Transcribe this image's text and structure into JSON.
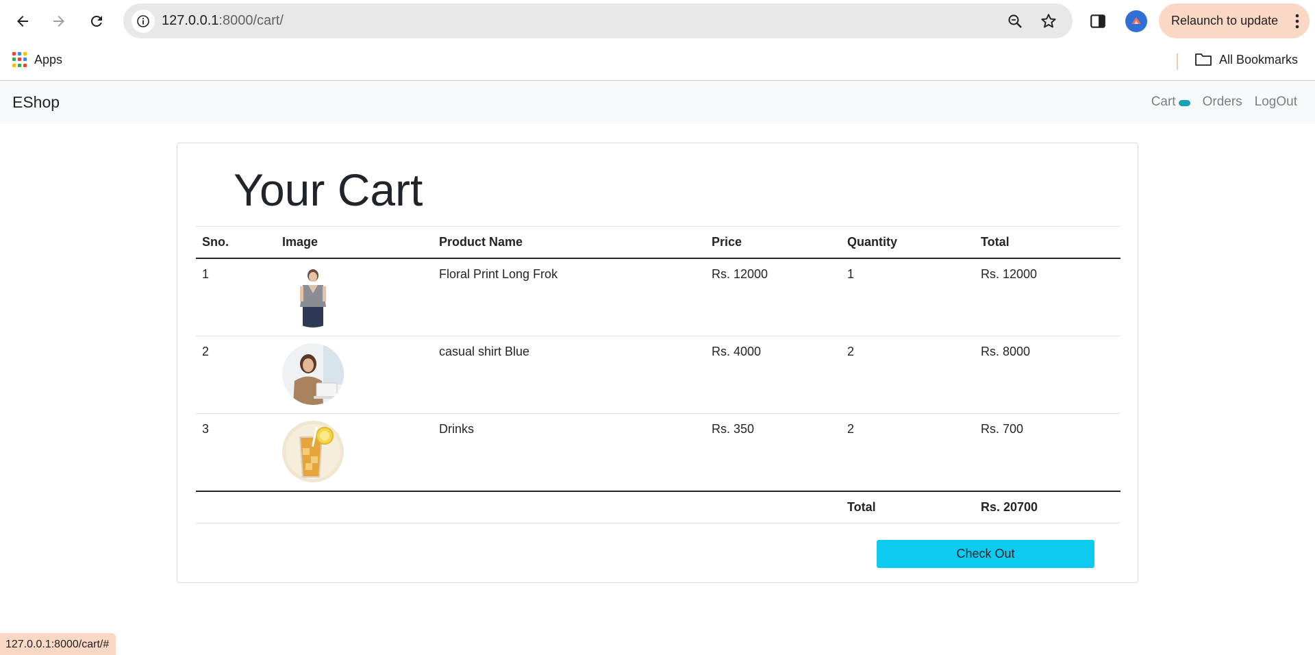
{
  "browser": {
    "url_host": "127.0.0.1",
    "url_rest": ":8000/cart/",
    "relaunch_label": "Relaunch to update",
    "bookmarks": {
      "apps_label": "Apps",
      "all_label": "All Bookmarks"
    },
    "status_url": "127.0.0.1:8000/cart/#"
  },
  "navbar": {
    "brand": "EShop",
    "links": {
      "cart": "Cart",
      "orders": "Orders",
      "logout": "LogOut"
    }
  },
  "cart": {
    "title": "Your Cart",
    "headers": {
      "sno": "Sno.",
      "image": "Image",
      "name": "Product Name",
      "price": "Price",
      "quantity": "Quantity",
      "total": "Total"
    },
    "items": [
      {
        "sno": "1",
        "name": "Floral Print Long Frok",
        "price": "Rs. 12000",
        "quantity": "1",
        "total": "Rs. 12000",
        "image_icon": "woman-top-product-image"
      },
      {
        "sno": "2",
        "name": "casual shirt Blue",
        "price": "Rs. 4000",
        "quantity": "2",
        "total": "Rs. 8000",
        "image_icon": "woman-laptop-product-image"
      },
      {
        "sno": "3",
        "name": "Drinks",
        "price": "Rs. 350",
        "quantity": "2",
        "total": "Rs. 700",
        "image_icon": "iced-drink-product-image"
      }
    ],
    "grand_total_label": "Total",
    "grand_total_value": "Rs. 20700",
    "checkout_label": "Check Out"
  },
  "colors": {
    "checkout": "#0dcaf0",
    "badge": "#17a2b8",
    "relaunch": "#fbd7c6"
  }
}
